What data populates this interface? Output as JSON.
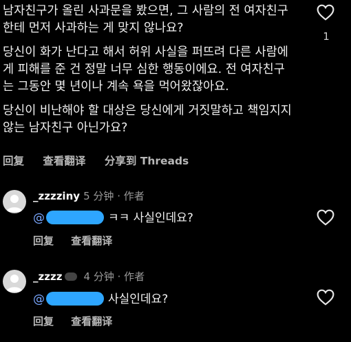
{
  "comment": {
    "paragraphs": [
      "남자친구가 올린 사과문을 봤으면, 그 사람의 전 여자친구한테 먼저 사과하는 게 맞지 않나요?",
      "당신이 화가 난다고 해서 허위 사실을 퍼뜨려 다른 사람에게 피해를 준 건 정말 너무 심한 행동이에요. 전 여자친구는 그동안 몇 년이나 계속 욕을 먹어왔잖아요.",
      "당신이 비난해야 할 대상은 당신에게 거짓말하고 책임지지 않는 남자친구 아닌가요?"
    ],
    "like_count": "1",
    "actions": {
      "reply": "回复",
      "translate": "查看翻译",
      "share": "分享到 Threads"
    }
  },
  "replies": [
    {
      "username": "_zzzziny",
      "meta": "5 分钟 · 作者",
      "mention": "@",
      "text": "ㅋㅋ 사실인데요?",
      "actions": {
        "reply": "回复",
        "translate": "查看翻译"
      }
    },
    {
      "username": "_zzzz",
      "meta": "4 分钟 · 作者",
      "mention": "@",
      "text": "사실인데요?",
      "actions": {
        "reply": "回复",
        "translate": "查看翻译"
      }
    }
  ],
  "colors": {
    "background": "#000000",
    "text": "#f0f0f0",
    "muted": "#9a9a9a",
    "redaction": "#2ea6ff"
  }
}
